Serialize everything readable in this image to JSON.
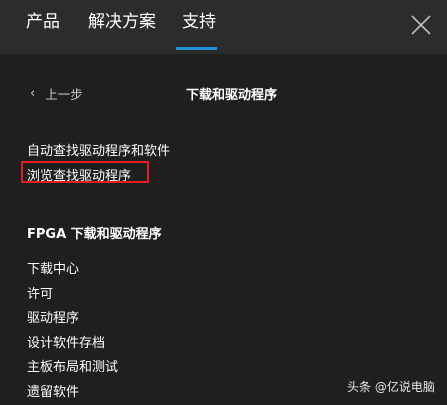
{
  "header": {
    "tabs": [
      {
        "label": "产品"
      },
      {
        "label": "解决方案"
      },
      {
        "label": "支持"
      }
    ],
    "active_tab_color": "#1e8fd8",
    "close_icon": "close-icon"
  },
  "nav": {
    "back_label": "上一步",
    "page_heading": "下载和驱动程序"
  },
  "links": {
    "auto_find": "自动查找驱动程序和软件",
    "browse_find": "浏览查找驱动程序",
    "highlight_color": "#e02020"
  },
  "fpga": {
    "heading": "FPGA 下载和驱动程序",
    "items": [
      {
        "label": "下载中心"
      },
      {
        "label": "许可"
      },
      {
        "label": "驱动程序"
      },
      {
        "label": "设计软件存档"
      },
      {
        "label": "主板布局和测试"
      },
      {
        "label": "遗留软件"
      }
    ]
  },
  "watermark": "头条 @亿说电脑"
}
